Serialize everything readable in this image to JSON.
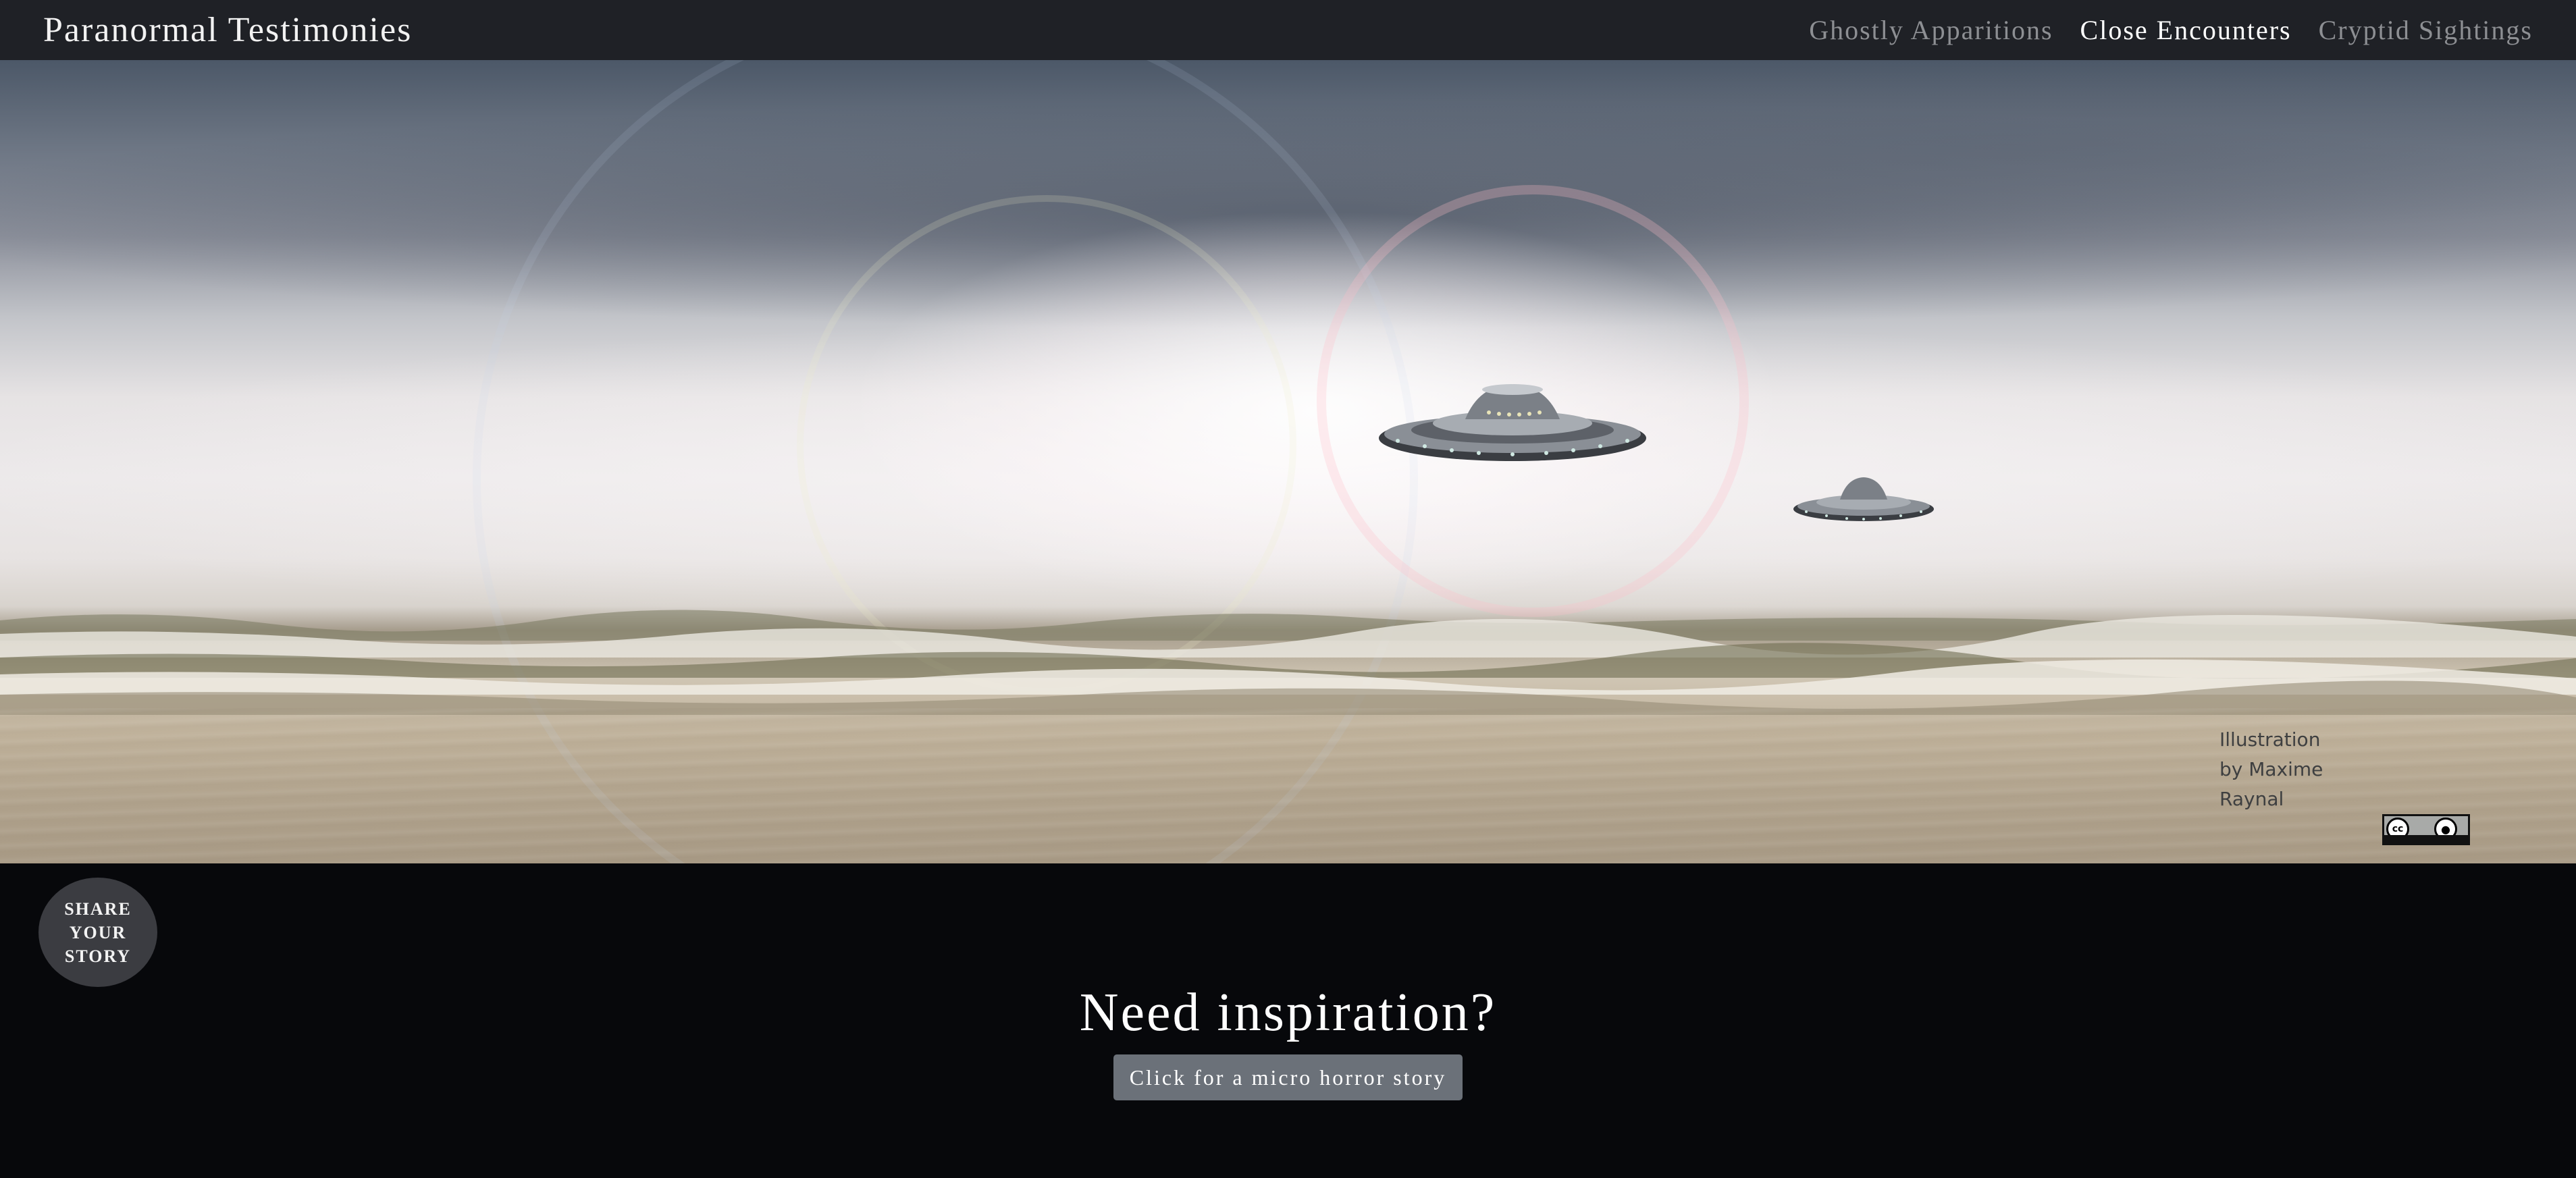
{
  "navbar": {
    "brand": "Paranormal Testimonies",
    "links": [
      {
        "label": "Ghostly Apparitions",
        "active": false
      },
      {
        "label": "Close Encounters",
        "active": true
      },
      {
        "label": "Cryptid Sightings",
        "active": false
      }
    ]
  },
  "hero": {
    "credit": "Illustration by Maxime Raynal",
    "license_badge": {
      "cc": "cc",
      "by": "BY"
    }
  },
  "share_button": {
    "label": "SHARE\nYOUR\nSTORY"
  },
  "inspiration": {
    "heading": "Need inspiration?",
    "button_label": "Click for a micro horror story"
  },
  "colors": {
    "navbar_bg": "#1f2126",
    "page_bg": "#07080b",
    "nav_active": "#ffffff",
    "nav_inactive": "#8d8f93",
    "button_bg": "#6b7179",
    "share_bg": "#3b3c41"
  }
}
